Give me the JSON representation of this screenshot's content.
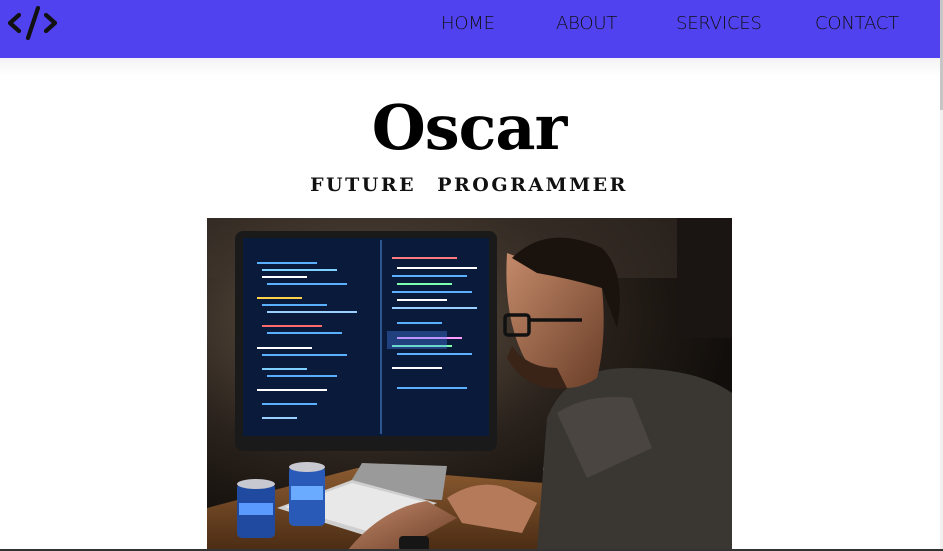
{
  "nav": {
    "logo_icon": "code-brackets-icon",
    "links": [
      "HOME",
      "ABOUT",
      "SERVICES",
      "CONTACT"
    ]
  },
  "hero": {
    "title": "Oscar",
    "subtitle": "FUTURE PROGRAMMER"
  },
  "colors": {
    "navbar": "#5142f0",
    "text": "#000000",
    "background": "#ffffff"
  }
}
